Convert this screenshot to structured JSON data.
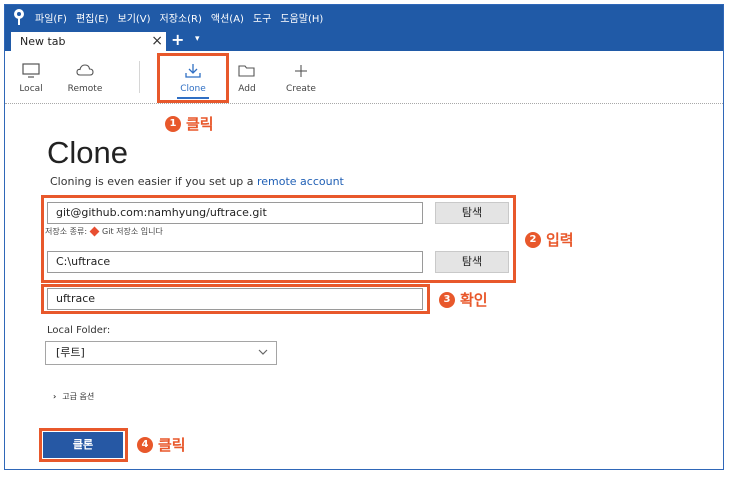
{
  "menu": [
    "파일(F)",
    "편집(E)",
    "보기(V)",
    "저장소(R)",
    "액션(A)",
    "도구",
    "도움말(H)"
  ],
  "tab": {
    "label": "New tab",
    "close": "×",
    "add": "+",
    "menu": "▾"
  },
  "toolbar": {
    "local": "Local",
    "remote": "Remote",
    "clone": "Clone",
    "add": "Add",
    "create": "Create"
  },
  "callouts": {
    "c1_num": "1",
    "c1_text": "클릭",
    "c2_num": "2",
    "c2_text": "입력",
    "c3_num": "3",
    "c3_text": "확인",
    "c4_num": "4",
    "c4_text": "클릭"
  },
  "clone": {
    "title": "Clone",
    "subtitle_prefix": "Cloning is even easier if you set up a ",
    "subtitle_link": "remote account",
    "source_url": "git@github.com:namhyung/uftrace.git",
    "browse_label": "탐색",
    "repo_type_prefix": "저장소 종류:",
    "repo_type_value": "Git 저장소 입니다",
    "dest_path": "C:\\uftrace",
    "browse_label_2": "탐색",
    "name": "uftrace",
    "local_folder_label": "Local Folder:",
    "local_folder_value": "[루트]",
    "advanced_options": "고급 옵션",
    "clone_button": "클론"
  },
  "colors": {
    "accent": "#205aa7",
    "callout": "#e8582b",
    "primary_button": "#2658a4"
  }
}
